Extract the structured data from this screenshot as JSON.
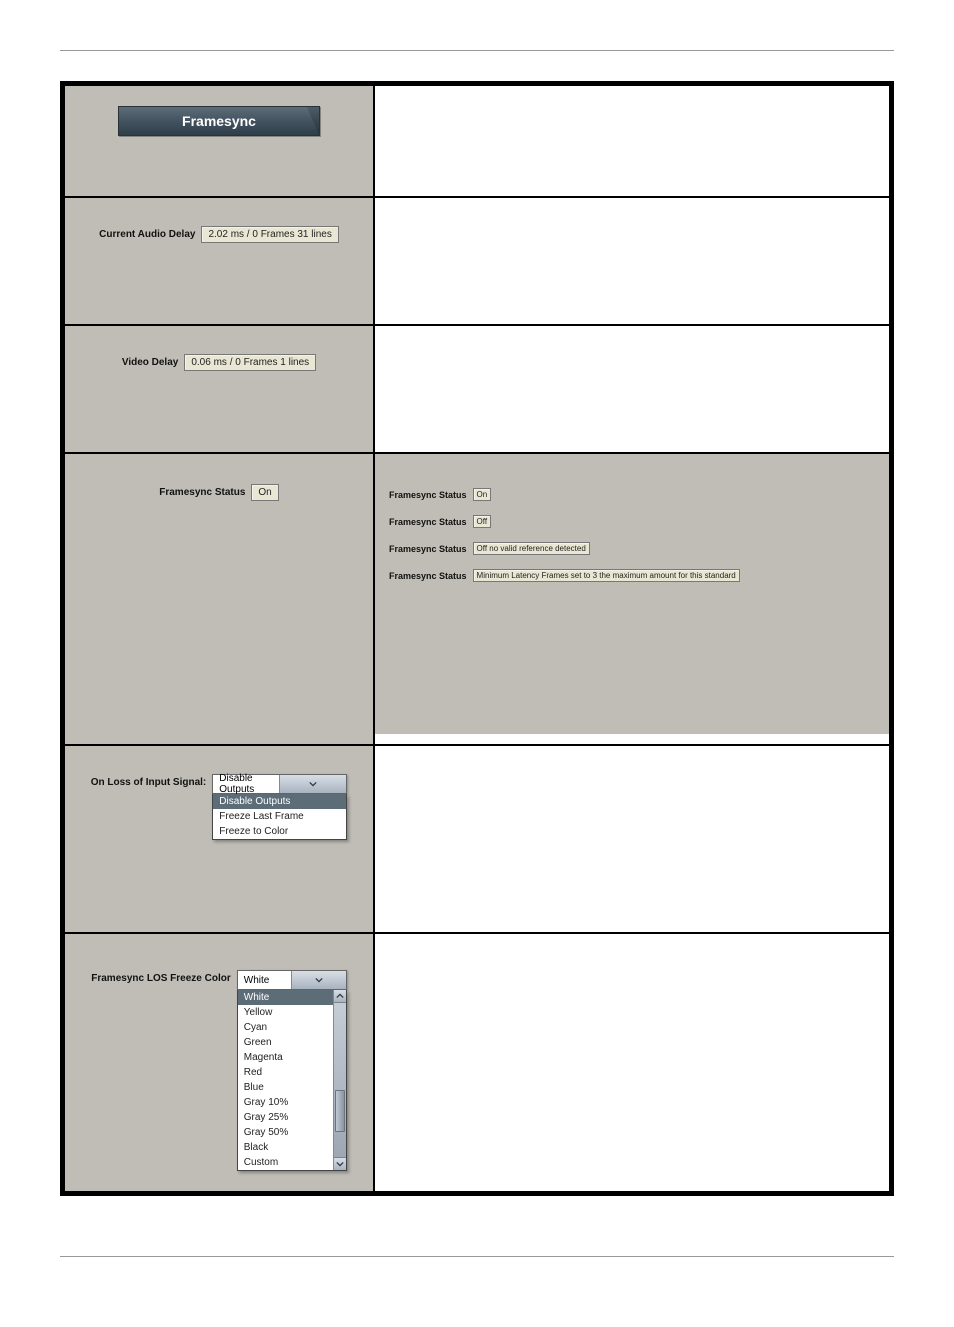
{
  "header": {
    "tab_label": "Framesync"
  },
  "audio_delay": {
    "label": "Current Audio Delay",
    "value": "2.02 ms / 0 Frames 31 lines"
  },
  "video_delay": {
    "label": "Video Delay",
    "value": "0.06 ms / 0 Frames 1 lines"
  },
  "framesync_status": {
    "label": "Framesync Status",
    "value": "On"
  },
  "status_examples": {
    "s1": {
      "label": "Framesync Status",
      "value": "On"
    },
    "s2": {
      "label": "Framesync Status",
      "value": "Off"
    },
    "s3": {
      "label": "Framesync Status",
      "value": "Off no valid reference detected"
    },
    "s4": {
      "label": "Framesync Status",
      "value": "Minimum Latency Frames set to 3 the maximum amount for this standard"
    }
  },
  "loss_of_input": {
    "label": "On Loss of Input Signal:",
    "selected": "Disable Outputs",
    "options": [
      "Disable Outputs",
      "Freeze Last Frame",
      "Freeze to Color"
    ]
  },
  "los_freeze_color": {
    "label": "Framesync LOS Freeze Color",
    "selected": "White",
    "options": [
      "White",
      "Yellow",
      "Cyan",
      "Green",
      "Magenta",
      "Red",
      "Blue",
      "Gray 10%",
      "Gray 25%",
      "Gray 50%",
      "Black",
      "Custom"
    ]
  }
}
